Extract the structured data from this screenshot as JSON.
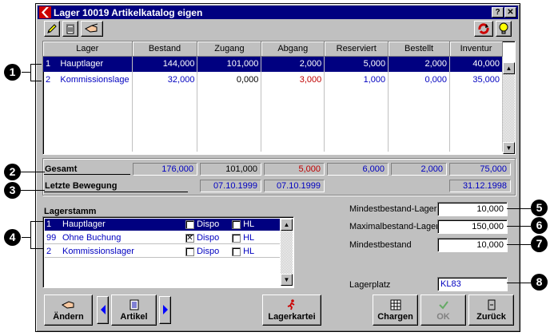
{
  "window": {
    "title": "Lager 10019 Artikelkatalog eigen",
    "help_label": "?",
    "close_label": "✕"
  },
  "toolbar": {
    "edit_icon": "pencil-icon",
    "delete_icon": "trash-icon",
    "hand_icon": "pointing-hand-icon",
    "refresh_icon": "refresh-icon",
    "info_icon": "lightbulb-icon"
  },
  "grid": {
    "columns": [
      "Lager",
      "Bestand",
      "Zugang",
      "Abgang",
      "Reserviert",
      "Bestellt",
      "Inventur"
    ],
    "rows": [
      {
        "nr": "1",
        "lager": "Hauptlager",
        "bestand": "144,000",
        "zugang": "101,000",
        "abgang": "2,000",
        "reserviert": "5,000",
        "bestellt": "2,000",
        "inventur": "40,000"
      },
      {
        "nr": "2",
        "lager": "Kommissionslage",
        "bestand": "32,000",
        "zugang": "0,000",
        "abgang": "3,000",
        "reserviert": "1,000",
        "bestellt": "0,000",
        "inventur": "35,000"
      }
    ]
  },
  "totals": {
    "label": "Gesamt",
    "bestand": "176,000",
    "zugang": "101,000",
    "abgang": "5,000",
    "reserviert": "6,000",
    "bestellt": "2,000",
    "inventur": "75,000"
  },
  "last_move": {
    "label": "Letzte Bewegung",
    "zugang": "07.10.1999",
    "abgang": "07.10.1999",
    "inventur": "31.12.1998"
  },
  "lagerstamm": {
    "title": "Lagerstamm",
    "rows": [
      {
        "nr": "1",
        "name": "Hauptlager",
        "dispo": "Dispo",
        "dispo_checked": "",
        "hl": "HL",
        "hl_checked": ""
      },
      {
        "nr": "99",
        "name": "Ohne Buchung",
        "dispo": "Dispo",
        "dispo_checked": "✕",
        "hl": "HL",
        "hl_checked": ""
      },
      {
        "nr": "2",
        "name": "Kommissionslager",
        "dispo": "Dispo",
        "dispo_checked": "",
        "hl": "HL",
        "hl_checked": ""
      }
    ]
  },
  "fields": {
    "min_lager_label": "Mindestbestand-Lager",
    "min_lager_value": "10,000",
    "max_lager_label": "Maximalbestand-Lager",
    "max_lager_value": "150,000",
    "min_label": "Mindestbestand",
    "min_value": "10,000",
    "lagerplatz_label": "Lagerplatz",
    "lagerplatz_value": "KL83"
  },
  "buttons": {
    "aendern": "Ändern",
    "artikel": "Artikel",
    "lagerkartei": "Lagerkartei",
    "chargen": "Chargen",
    "ok": "OK",
    "zurueck": "Zurück"
  },
  "callouts": [
    "1",
    "2",
    "3",
    "4",
    "5",
    "6",
    "7",
    "8"
  ]
}
